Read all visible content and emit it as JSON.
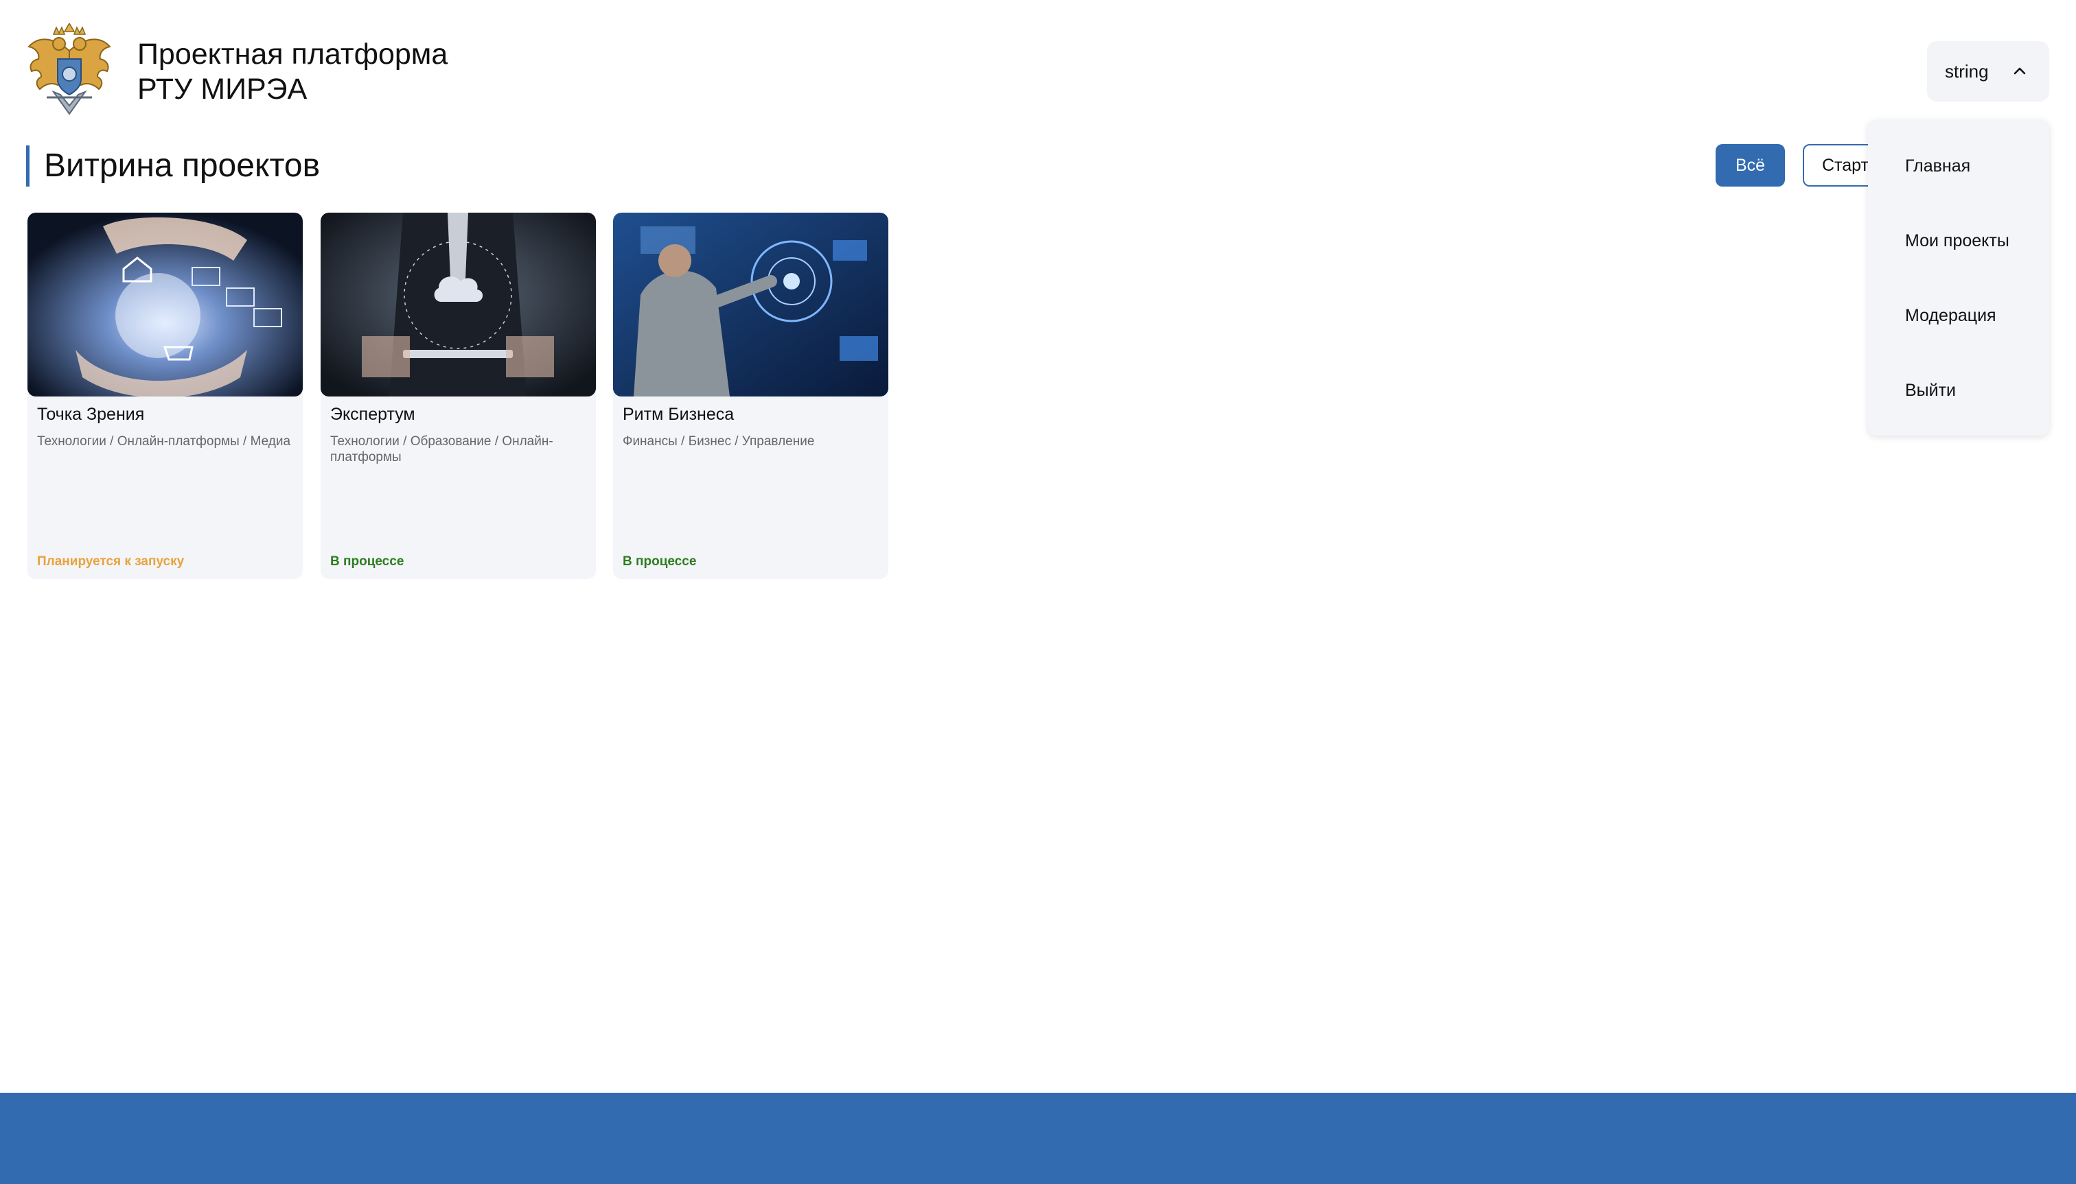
{
  "header": {
    "brand_line1": "Проектная платформа",
    "brand_line2": "РТУ МИРЭА",
    "user_label": "string"
  },
  "main": {
    "title": "Витрина проектов",
    "filters": {
      "all_label": "Всё",
      "startup_label": "Старт"
    }
  },
  "menu": {
    "items": [
      {
        "label": "Главная"
      },
      {
        "label": "Мои проекты"
      },
      {
        "label": "Модерация"
      },
      {
        "label": "Выйти"
      }
    ]
  },
  "projects": [
    {
      "name": "Точка Зрения",
      "tags": "Технологии / Онлайн-платформы / Медиа",
      "status": "Планируется к запуску",
      "status_color": "#e8a33d"
    },
    {
      "name": "Экспертум",
      "tags": "Технологии / Образование / Онлайн-платформы",
      "status": "В процессе",
      "status_color": "#2e7d1f"
    },
    {
      "name": "Ритм Бизнеса",
      "tags": "Финансы / Бизнес / Управление",
      "status": "В процессе",
      "status_color": "#2e7d1f"
    }
  ],
  "colors": {
    "accent": "#336bb0",
    "menu_bg": "#f4f5f8",
    "card_bg": "#f3f5f9"
  },
  "icons": {
    "logo": "double-headed-eagle-emblem",
    "user_chevron": "chevron-up-icon"
  }
}
